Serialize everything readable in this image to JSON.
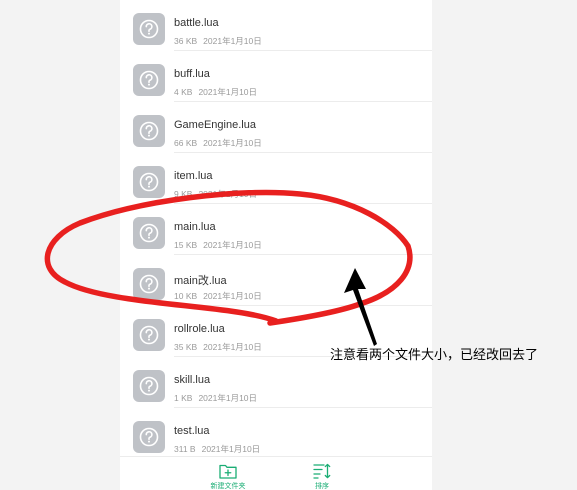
{
  "files": [
    {
      "name": "battle.lua",
      "size": "36 KB",
      "date": "2021年1月10日"
    },
    {
      "name": "buff.lua",
      "size": "4 KB",
      "date": "2021年1月10日"
    },
    {
      "name": "GameEngine.lua",
      "size": "66 KB",
      "date": "2021年1月10日"
    },
    {
      "name": "item.lua",
      "size": "9 KB",
      "date": "2021年1月10日"
    },
    {
      "name": "main.lua",
      "size": "15 KB",
      "date": "2021年1月10日"
    },
    {
      "name": "main改.lua",
      "size": "10 KB",
      "date": "2021年1月10日"
    },
    {
      "name": "rollrole.lua",
      "size": "35 KB",
      "date": "2021年1月10日"
    },
    {
      "name": "skill.lua",
      "size": "1 KB",
      "date": "2021年1月10日"
    },
    {
      "name": "test.lua",
      "size": "311 B",
      "date": "2021年1月10日"
    }
  ],
  "icons": {
    "file": "unknown-file-icon",
    "new_folder": "new-folder-icon",
    "sort": "sort-icon"
  },
  "bottom_bar": {
    "new_folder_label": "新建文件夹",
    "sort_label": "排序"
  },
  "annotation": {
    "text": "注意看两个文件大小，已经改回去了"
  },
  "colors": {
    "accent": "#1aad74",
    "annotation_mark": "#e8201f",
    "file_icon": "#bfc2c7"
  }
}
